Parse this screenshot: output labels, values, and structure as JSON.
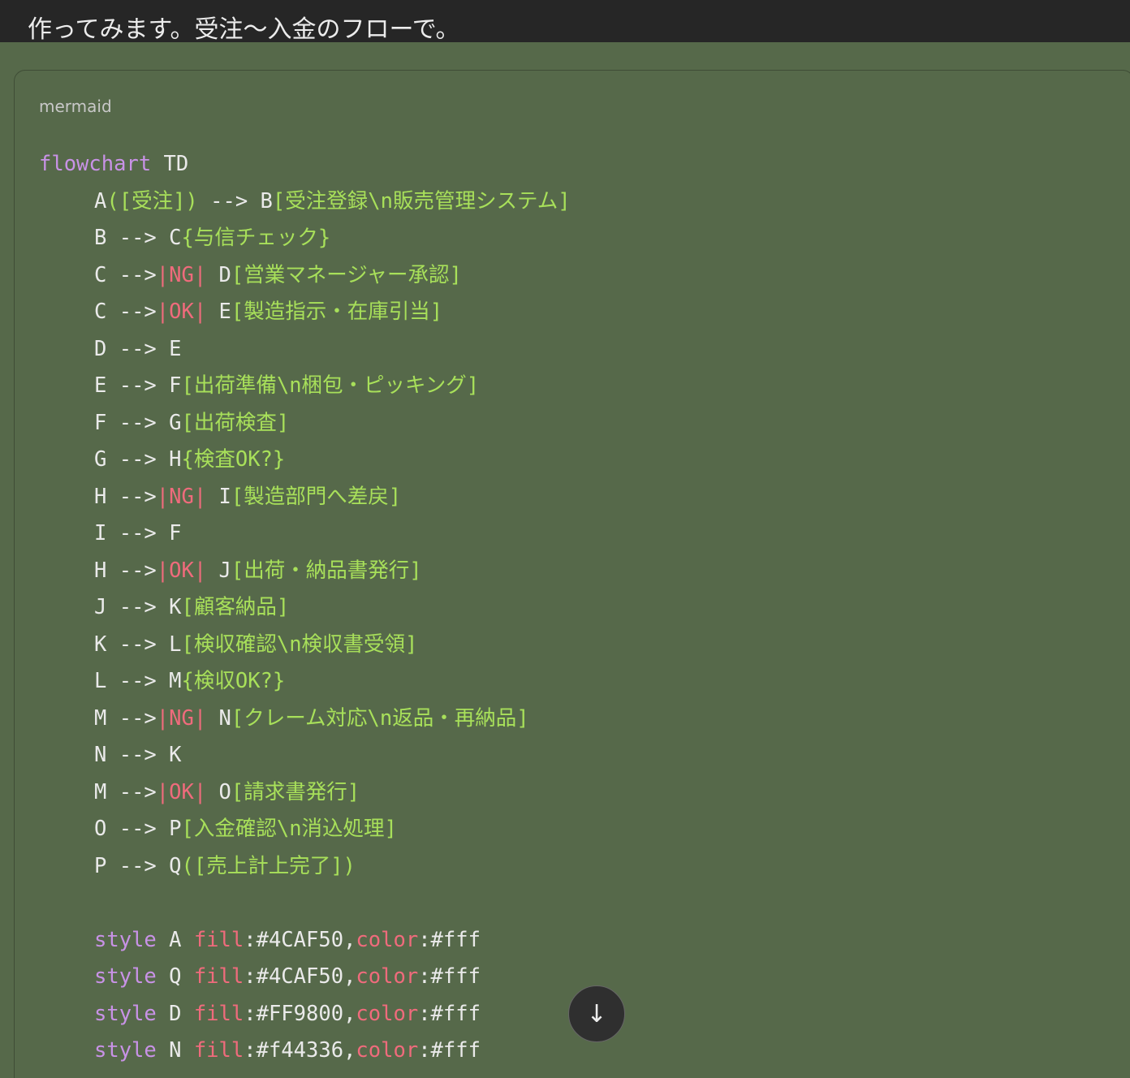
{
  "message": {
    "intro_text": "作ってみます。受注〜入金のフローで。"
  },
  "code_block": {
    "language_label": "mermaid",
    "lines": [
      [
        {
          "t": "kw",
          "v": "flowchart"
        },
        {
          "t": "node",
          "v": " TD"
        }
      ],
      [
        {
          "t": "ind"
        },
        {
          "t": "node",
          "v": "A"
        },
        {
          "t": "str",
          "v": "([受注])"
        },
        {
          "t": "arrow",
          "v": " --> "
        },
        {
          "t": "node",
          "v": "B"
        },
        {
          "t": "str",
          "v": "[受注登録\\n販売管理システム]"
        }
      ],
      [
        {
          "t": "ind"
        },
        {
          "t": "node",
          "v": "B"
        },
        {
          "t": "arrow",
          "v": " --> "
        },
        {
          "t": "node",
          "v": "C"
        },
        {
          "t": "str",
          "v": "{与信チェック}"
        }
      ],
      [
        {
          "t": "ind"
        },
        {
          "t": "node",
          "v": "C"
        },
        {
          "t": "arrow",
          "v": " -->"
        },
        {
          "t": "lbl",
          "v": "|NG|"
        },
        {
          "t": "node",
          "v": " D"
        },
        {
          "t": "str",
          "v": "[営業マネージャー承認]"
        }
      ],
      [
        {
          "t": "ind"
        },
        {
          "t": "node",
          "v": "C"
        },
        {
          "t": "arrow",
          "v": " -->"
        },
        {
          "t": "lbl",
          "v": "|OK|"
        },
        {
          "t": "node",
          "v": " E"
        },
        {
          "t": "str",
          "v": "[製造指示・在庫引当]"
        }
      ],
      [
        {
          "t": "ind"
        },
        {
          "t": "node",
          "v": "D"
        },
        {
          "t": "arrow",
          "v": " --> "
        },
        {
          "t": "node",
          "v": "E"
        }
      ],
      [
        {
          "t": "ind"
        },
        {
          "t": "node",
          "v": "E"
        },
        {
          "t": "arrow",
          "v": " --> "
        },
        {
          "t": "node",
          "v": "F"
        },
        {
          "t": "str",
          "v": "[出荷準備\\n梱包・ピッキング]"
        }
      ],
      [
        {
          "t": "ind"
        },
        {
          "t": "node",
          "v": "F"
        },
        {
          "t": "arrow",
          "v": " --> "
        },
        {
          "t": "node",
          "v": "G"
        },
        {
          "t": "str",
          "v": "[出荷検査]"
        }
      ],
      [
        {
          "t": "ind"
        },
        {
          "t": "node",
          "v": "G"
        },
        {
          "t": "arrow",
          "v": " --> "
        },
        {
          "t": "node",
          "v": "H"
        },
        {
          "t": "str",
          "v": "{検査OK?}"
        }
      ],
      [
        {
          "t": "ind"
        },
        {
          "t": "node",
          "v": "H"
        },
        {
          "t": "arrow",
          "v": " -->"
        },
        {
          "t": "lbl",
          "v": "|NG|"
        },
        {
          "t": "node",
          "v": " I"
        },
        {
          "t": "str",
          "v": "[製造部門へ差戻]"
        }
      ],
      [
        {
          "t": "ind"
        },
        {
          "t": "node",
          "v": "I"
        },
        {
          "t": "arrow",
          "v": " --> "
        },
        {
          "t": "node",
          "v": "F"
        }
      ],
      [
        {
          "t": "ind"
        },
        {
          "t": "node",
          "v": "H"
        },
        {
          "t": "arrow",
          "v": " -->"
        },
        {
          "t": "lbl",
          "v": "|OK|"
        },
        {
          "t": "node",
          "v": " J"
        },
        {
          "t": "str",
          "v": "[出荷・納品書発行]"
        }
      ],
      [
        {
          "t": "ind"
        },
        {
          "t": "node",
          "v": "J"
        },
        {
          "t": "arrow",
          "v": " --> "
        },
        {
          "t": "node",
          "v": "K"
        },
        {
          "t": "str",
          "v": "[顧客納品]"
        }
      ],
      [
        {
          "t": "ind"
        },
        {
          "t": "node",
          "v": "K"
        },
        {
          "t": "arrow",
          "v": " --> "
        },
        {
          "t": "node",
          "v": "L"
        },
        {
          "t": "str",
          "v": "[検収確認\\n検収書受領]"
        }
      ],
      [
        {
          "t": "ind"
        },
        {
          "t": "node",
          "v": "L"
        },
        {
          "t": "arrow",
          "v": " --> "
        },
        {
          "t": "node",
          "v": "M"
        },
        {
          "t": "str",
          "v": "{検収OK?}"
        }
      ],
      [
        {
          "t": "ind"
        },
        {
          "t": "node",
          "v": "M"
        },
        {
          "t": "arrow",
          "v": " -->"
        },
        {
          "t": "lbl",
          "v": "|NG|"
        },
        {
          "t": "node",
          "v": " N"
        },
        {
          "t": "str",
          "v": "[クレーム対応\\n返品・再納品]"
        }
      ],
      [
        {
          "t": "ind"
        },
        {
          "t": "node",
          "v": "N"
        },
        {
          "t": "arrow",
          "v": " --> "
        },
        {
          "t": "node",
          "v": "K"
        }
      ],
      [
        {
          "t": "ind"
        },
        {
          "t": "node",
          "v": "M"
        },
        {
          "t": "arrow",
          "v": " -->"
        },
        {
          "t": "lbl",
          "v": "|OK|"
        },
        {
          "t": "node",
          "v": " O"
        },
        {
          "t": "str",
          "v": "[請求書発行]"
        }
      ],
      [
        {
          "t": "ind"
        },
        {
          "t": "node",
          "v": "O"
        },
        {
          "t": "arrow",
          "v": " --> "
        },
        {
          "t": "node",
          "v": "P"
        },
        {
          "t": "str",
          "v": "[入金確認\\n消込処理]"
        }
      ],
      [
        {
          "t": "ind"
        },
        {
          "t": "node",
          "v": "P"
        },
        {
          "t": "arrow",
          "v": " --> "
        },
        {
          "t": "node",
          "v": "Q"
        },
        {
          "t": "str",
          "v": "([売上計上完了])"
        }
      ],
      [],
      [
        {
          "t": "ind"
        },
        {
          "t": "kw",
          "v": "style"
        },
        {
          "t": "node",
          "v": " A "
        },
        {
          "t": "prop",
          "v": "fill"
        },
        {
          "t": "punct",
          "v": ":#4CAF50,"
        },
        {
          "t": "prop",
          "v": "color"
        },
        {
          "t": "punct",
          "v": ":#fff"
        }
      ],
      [
        {
          "t": "ind"
        },
        {
          "t": "kw",
          "v": "style"
        },
        {
          "t": "node",
          "v": " Q "
        },
        {
          "t": "prop",
          "v": "fill"
        },
        {
          "t": "punct",
          "v": ":#4CAF50,"
        },
        {
          "t": "prop",
          "v": "color"
        },
        {
          "t": "punct",
          "v": ":#fff"
        }
      ],
      [
        {
          "t": "ind"
        },
        {
          "t": "kw",
          "v": "style"
        },
        {
          "t": "node",
          "v": " D "
        },
        {
          "t": "prop",
          "v": "fill"
        },
        {
          "t": "punct",
          "v": ":#FF9800,"
        },
        {
          "t": "prop",
          "v": "color"
        },
        {
          "t": "punct",
          "v": ":#fff"
        }
      ],
      [
        {
          "t": "ind"
        },
        {
          "t": "kw",
          "v": "style"
        },
        {
          "t": "node",
          "v": " N "
        },
        {
          "t": "prop",
          "v": "fill"
        },
        {
          "t": "punct",
          "v": ":#f44336,"
        },
        {
          "t": "prop",
          "v": "color"
        },
        {
          "t": "punct",
          "v": ":#fff"
        }
      ]
    ]
  },
  "scroll_button": {
    "icon": "arrow-down-icon",
    "glyph": "↓"
  },
  "colors": {
    "background": "#56694a",
    "top_strip": "#262626",
    "keyword": "#c892e6",
    "label": "#ef6b7c",
    "string": "#a8e05a",
    "text": "#eaeaea"
  }
}
